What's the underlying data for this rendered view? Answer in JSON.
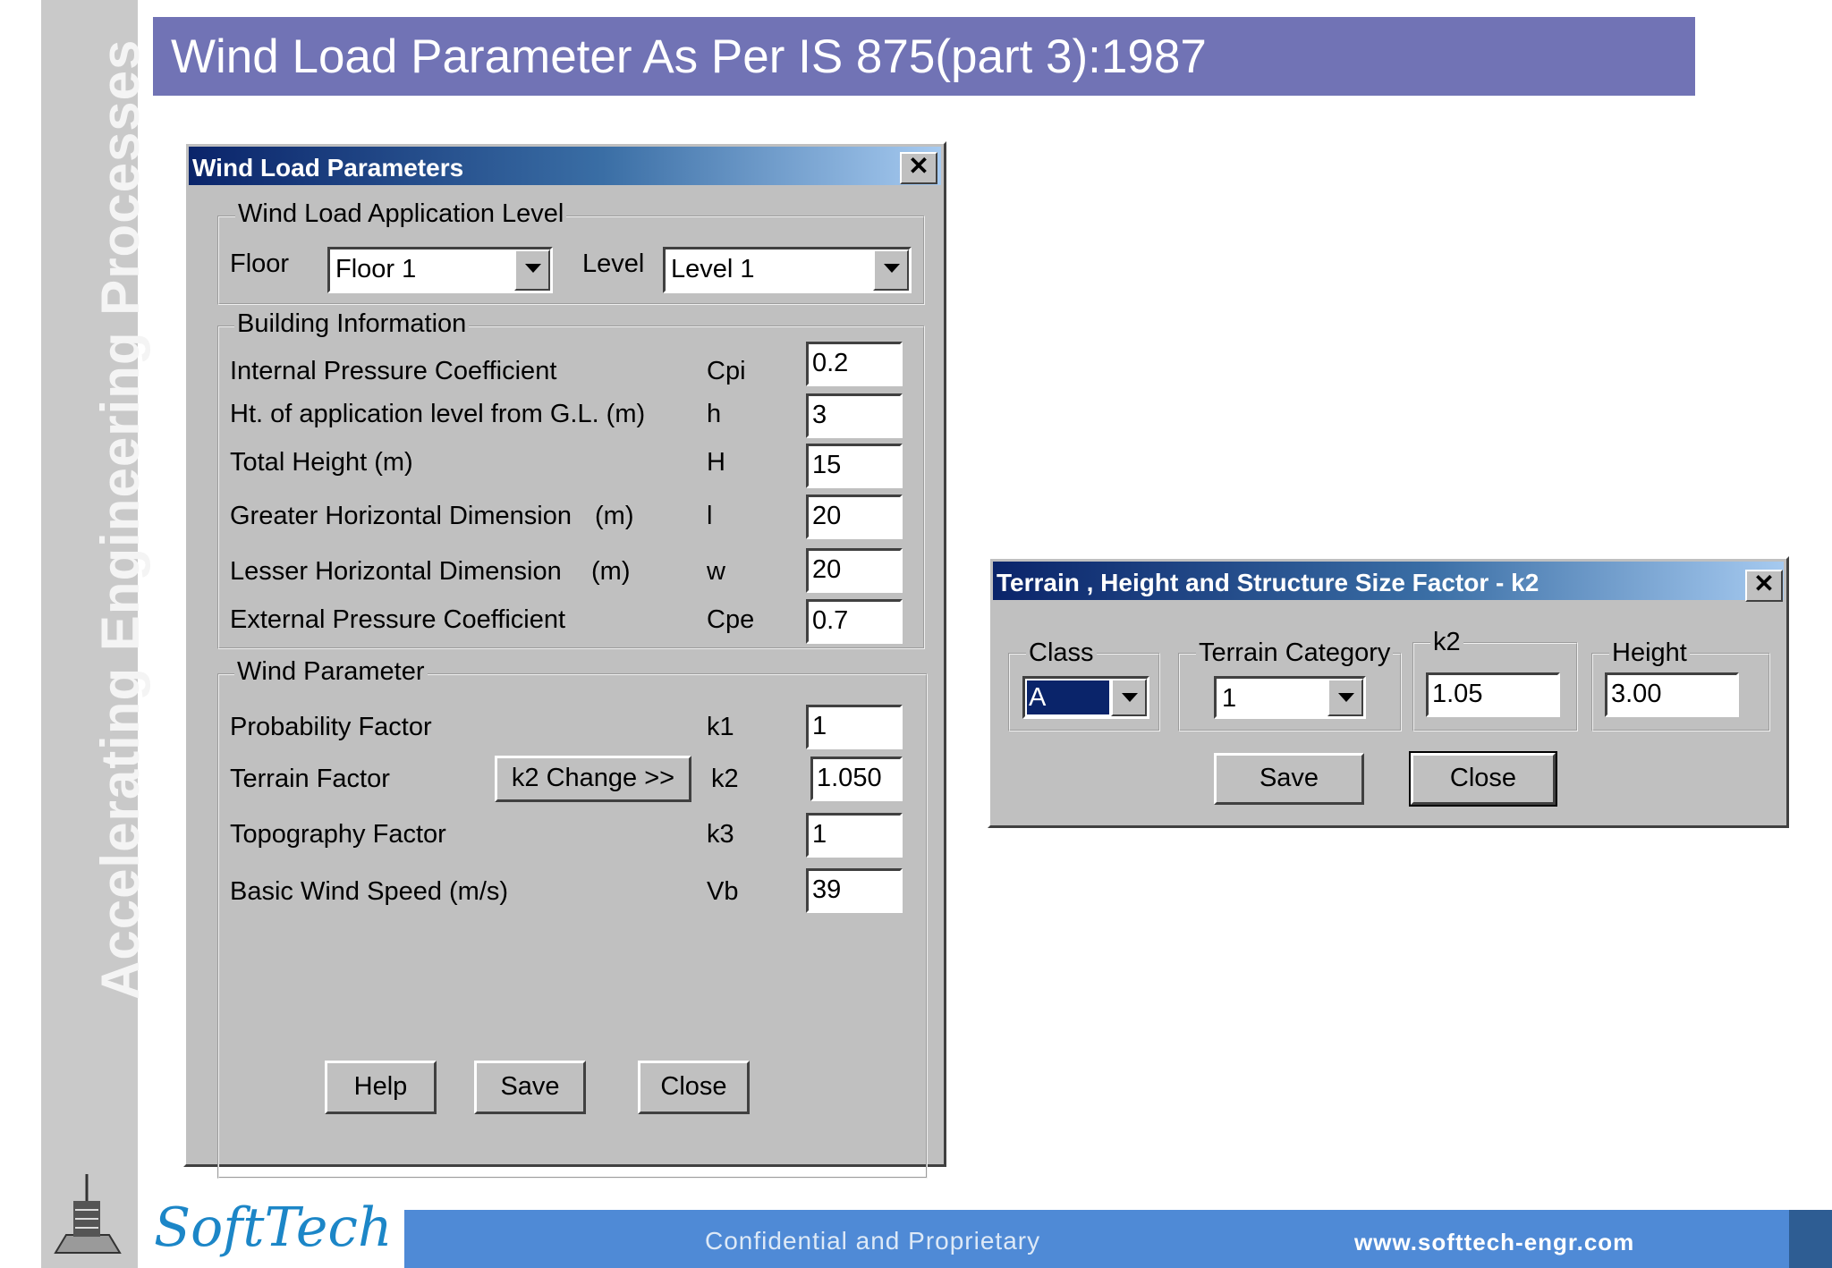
{
  "slide": {
    "title": "Wind Load Parameter As Per IS 875(part 3):1987",
    "side_text": "Accelerating Engineering Processes"
  },
  "wind_dialog": {
    "title": "Wind Load Parameters",
    "close_glyph": "✕",
    "application_group": {
      "label": "Wind Load Application Level",
      "floor_label": "Floor",
      "floor_value": "Floor 1",
      "level_label": "Level",
      "level_value": "Level 1"
    },
    "building_group": {
      "label": "Building Information",
      "rows": [
        {
          "name": "Internal Pressure  Coefficient",
          "unit": "",
          "symbol": "Cpi",
          "value": "0.2"
        },
        {
          "name": "Ht. of application level from G.L. (m)",
          "unit": "",
          "symbol": "h",
          "value": "3"
        },
        {
          "name": "Total Height (m)",
          "unit": "",
          "symbol": "H",
          "value": "15"
        },
        {
          "name": "Greater Horizontal Dimension",
          "unit": "(m)",
          "symbol": "l",
          "value": "20"
        },
        {
          "name": "Lesser Horizontal Dimension",
          "unit": "(m)",
          "symbol": "w",
          "value": "20"
        },
        {
          "name": "External Pressure Coefficient",
          "unit": "",
          "symbol": "Cpe",
          "value": "0.7"
        }
      ]
    },
    "wind_group": {
      "label": "Wind Parameter",
      "k2_button": "k2 Change >>",
      "rows": [
        {
          "name": "Probability Factor",
          "symbol": "k1",
          "value": "1"
        },
        {
          "name": "Terrain Factor",
          "symbol": "k2",
          "value": "1.050"
        },
        {
          "name": "Topography Factor",
          "symbol": "k3",
          "value": "1"
        },
        {
          "name": "Basic Wind Speed (m/s)",
          "symbol": "Vb",
          "value": "39"
        }
      ]
    },
    "buttons": {
      "help": "Help",
      "save": "Save",
      "close": "Close"
    }
  },
  "terrain_dialog": {
    "title": "Terrain , Height and Structure Size Factor - k2",
    "close_glyph": "✕",
    "class_label": "Class",
    "class_value": "A",
    "terrain_label": "Terrain Category",
    "terrain_value": "1",
    "k2_label": "k2",
    "k2_value": "1.05",
    "height_label": "Height",
    "height_value": "3.00",
    "buttons": {
      "save": "Save",
      "close": "Close"
    }
  },
  "footer": {
    "brand": "SoftTech",
    "confidential": "Confidential and Proprietary",
    "url": "www.softtech-engr.com"
  }
}
